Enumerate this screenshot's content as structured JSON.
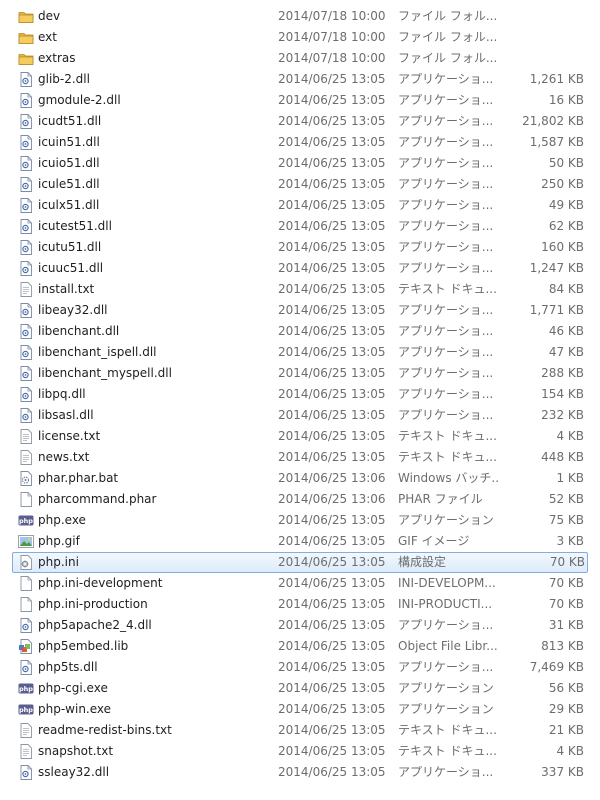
{
  "icons": {
    "folder": "folder-icon",
    "dll": "dll-file-icon",
    "text": "text-file-icon",
    "bat": "batch-file-icon",
    "phar": "generic-file-icon",
    "exe": "php-exe-icon",
    "gif": "gif-image-icon",
    "ini": "settings-file-icon",
    "plain": "generic-file-icon",
    "lib": "lib-file-icon"
  },
  "colors": {
    "folder": "#e8b73a",
    "selection_border": "#84acdd",
    "selection_fill": "#dcebfc",
    "php_icon_bg": "#5b5f8f"
  },
  "files": [
    {
      "name": "dev",
      "date": "2014/07/18 10:00",
      "type": "ファイル フォル...",
      "size": "",
      "icon": "folder"
    },
    {
      "name": "ext",
      "date": "2014/07/18 10:00",
      "type": "ファイル フォル...",
      "size": "",
      "icon": "folder"
    },
    {
      "name": "extras",
      "date": "2014/07/18 10:00",
      "type": "ファイル フォル...",
      "size": "",
      "icon": "folder"
    },
    {
      "name": "glib-2.dll",
      "date": "2014/06/25 13:05",
      "type": "アプリケーショ...",
      "size": "1,261 KB",
      "icon": "dll"
    },
    {
      "name": "gmodule-2.dll",
      "date": "2014/06/25 13:05",
      "type": "アプリケーショ...",
      "size": "16 KB",
      "icon": "dll"
    },
    {
      "name": "icudt51.dll",
      "date": "2014/06/25 13:05",
      "type": "アプリケーショ...",
      "size": "21,802 KB",
      "icon": "dll"
    },
    {
      "name": "icuin51.dll",
      "date": "2014/06/25 13:05",
      "type": "アプリケーショ...",
      "size": "1,587 KB",
      "icon": "dll"
    },
    {
      "name": "icuio51.dll",
      "date": "2014/06/25 13:05",
      "type": "アプリケーショ...",
      "size": "50 KB",
      "icon": "dll"
    },
    {
      "name": "icule51.dll",
      "date": "2014/06/25 13:05",
      "type": "アプリケーショ...",
      "size": "250 KB",
      "icon": "dll"
    },
    {
      "name": "iculx51.dll",
      "date": "2014/06/25 13:05",
      "type": "アプリケーショ...",
      "size": "49 KB",
      "icon": "dll"
    },
    {
      "name": "icutest51.dll",
      "date": "2014/06/25 13:05",
      "type": "アプリケーショ...",
      "size": "62 KB",
      "icon": "dll"
    },
    {
      "name": "icutu51.dll",
      "date": "2014/06/25 13:05",
      "type": "アプリケーショ...",
      "size": "160 KB",
      "icon": "dll"
    },
    {
      "name": "icuuc51.dll",
      "date": "2014/06/25 13:05",
      "type": "アプリケーショ...",
      "size": "1,247 KB",
      "icon": "dll"
    },
    {
      "name": "install.txt",
      "date": "2014/06/25 13:05",
      "type": "テキスト ドキュ...",
      "size": "84 KB",
      "icon": "text"
    },
    {
      "name": "libeay32.dll",
      "date": "2014/06/25 13:05",
      "type": "アプリケーショ...",
      "size": "1,771 KB",
      "icon": "dll"
    },
    {
      "name": "libenchant.dll",
      "date": "2014/06/25 13:05",
      "type": "アプリケーショ...",
      "size": "46 KB",
      "icon": "dll"
    },
    {
      "name": "libenchant_ispell.dll",
      "date": "2014/06/25 13:05",
      "type": "アプリケーショ...",
      "size": "47 KB",
      "icon": "dll"
    },
    {
      "name": "libenchant_myspell.dll",
      "date": "2014/06/25 13:05",
      "type": "アプリケーショ...",
      "size": "288 KB",
      "icon": "dll"
    },
    {
      "name": "libpq.dll",
      "date": "2014/06/25 13:05",
      "type": "アプリケーショ...",
      "size": "154 KB",
      "icon": "dll"
    },
    {
      "name": "libsasl.dll",
      "date": "2014/06/25 13:05",
      "type": "アプリケーショ...",
      "size": "232 KB",
      "icon": "dll"
    },
    {
      "name": "license.txt",
      "date": "2014/06/25 13:05",
      "type": "テキスト ドキュ...",
      "size": "4 KB",
      "icon": "text"
    },
    {
      "name": "news.txt",
      "date": "2014/06/25 13:05",
      "type": "テキスト ドキュ...",
      "size": "448 KB",
      "icon": "text"
    },
    {
      "name": "phar.phar.bat",
      "date": "2014/06/25 13:06",
      "type": "Windows バッチ...",
      "size": "1 KB",
      "icon": "bat"
    },
    {
      "name": "pharcommand.phar",
      "date": "2014/06/25 13:06",
      "type": "PHAR ファイル",
      "size": "52 KB",
      "icon": "phar"
    },
    {
      "name": "php.exe",
      "date": "2014/06/25 13:05",
      "type": "アプリケーション",
      "size": "75 KB",
      "icon": "exe"
    },
    {
      "name": "php.gif",
      "date": "2014/06/25 13:05",
      "type": "GIF イメージ",
      "size": "3 KB",
      "icon": "gif"
    },
    {
      "name": "php.ini",
      "date": "2014/06/25 13:05",
      "type": "構成設定",
      "size": "70 KB",
      "icon": "ini",
      "selected": true
    },
    {
      "name": "php.ini-development",
      "date": "2014/06/25 13:05",
      "type": "INI-DEVELOPM...",
      "size": "70 KB",
      "icon": "plain"
    },
    {
      "name": "php.ini-production",
      "date": "2014/06/25 13:05",
      "type": "INI-PRODUCTI...",
      "size": "70 KB",
      "icon": "plain"
    },
    {
      "name": "php5apache2_4.dll",
      "date": "2014/06/25 13:05",
      "type": "アプリケーショ...",
      "size": "31 KB",
      "icon": "dll"
    },
    {
      "name": "php5embed.lib",
      "date": "2014/06/25 13:05",
      "type": "Object File Libr...",
      "size": "813 KB",
      "icon": "lib"
    },
    {
      "name": "php5ts.dll",
      "date": "2014/06/25 13:05",
      "type": "アプリケーショ...",
      "size": "7,469 KB",
      "icon": "dll"
    },
    {
      "name": "php-cgi.exe",
      "date": "2014/06/25 13:05",
      "type": "アプリケーション",
      "size": "56 KB",
      "icon": "exe"
    },
    {
      "name": "php-win.exe",
      "date": "2014/06/25 13:05",
      "type": "アプリケーション",
      "size": "29 KB",
      "icon": "exe"
    },
    {
      "name": "readme-redist-bins.txt",
      "date": "2014/06/25 13:05",
      "type": "テキスト ドキュ...",
      "size": "21 KB",
      "icon": "text"
    },
    {
      "name": "snapshot.txt",
      "date": "2014/06/25 13:05",
      "type": "テキスト ドキュ...",
      "size": "4 KB",
      "icon": "text"
    },
    {
      "name": "ssleay32.dll",
      "date": "2014/06/25 13:05",
      "type": "アプリケーショ...",
      "size": "337 KB",
      "icon": "dll"
    }
  ]
}
